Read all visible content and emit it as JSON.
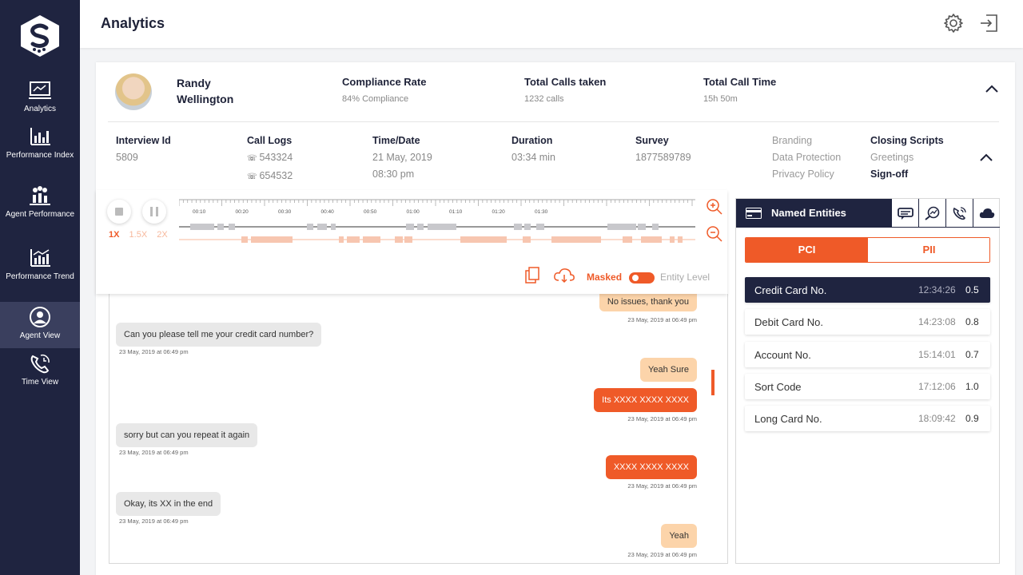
{
  "header": {
    "title": "Analytics"
  },
  "sidebar": {
    "items": [
      {
        "label": "Analytics",
        "icon": "monitor-analytics-icon"
      },
      {
        "label": "Performance Index",
        "icon": "bar-chart-icon"
      },
      {
        "label": "Agent Performance",
        "icon": "agents-chart-icon"
      },
      {
        "label": "Performance Trend",
        "icon": "trend-chart-icon"
      },
      {
        "label": "Agent View",
        "icon": "user-icon"
      },
      {
        "label": "Time View",
        "icon": "phone-clock-icon"
      }
    ],
    "active": "Agent View"
  },
  "agent": {
    "first_name": "Randy",
    "last_name": "Wellington",
    "stats": [
      {
        "label": "Compliance Rate",
        "value": "84% Compliance"
      },
      {
        "label": "Total Calls taken",
        "value": "1232 calls"
      },
      {
        "label": "Total Call Time",
        "value": "15h 50m"
      }
    ]
  },
  "call": {
    "interview_id_label": "Interview Id",
    "interview_id": "5809",
    "call_logs_label": "Call Logs",
    "call_logs": [
      "543324",
      "654532"
    ],
    "time_label": "Time/Date",
    "date": "21 May, 2019",
    "time": "08:30 pm",
    "duration_label": "Duration",
    "duration": "03:34 min",
    "survey_label": "Survey",
    "survey": "1877589789",
    "tags_col1": [
      "Branding",
      "Data Protection",
      "Privacy Policy"
    ],
    "tags_col2": [
      "Closing Scripts",
      "Greetings",
      "Sign-off"
    ]
  },
  "player": {
    "speeds": [
      "1X",
      "1.5X",
      "2X"
    ],
    "selected_speed": "1X",
    "ticks": [
      "00:10",
      "00:20",
      "00:30",
      "00:40",
      "00:50",
      "01:00",
      "01:10",
      "01:20",
      "01:30"
    ],
    "masked_label": "Masked",
    "entity_level_label": "Entity Level",
    "accent": "#ef5a28"
  },
  "chat": {
    "messages": [
      {
        "side": "out",
        "style": "light",
        "text": "No issues, thank you",
        "ts": "23 May, 2019 at 06:49 pm"
      },
      {
        "side": "in",
        "style": "grey",
        "text": "Can you please tell me your credit card number?",
        "ts": "23 May, 2019 at 06:49 pm"
      },
      {
        "side": "out",
        "style": "light",
        "text": "Yeah Sure",
        "ts": ""
      },
      {
        "side": "out",
        "style": "red",
        "text": "Its XXXX XXXX XXXX",
        "ts": "23 May, 2019 at 06:49 pm"
      },
      {
        "side": "in",
        "style": "grey",
        "text": "sorry but can you repeat it again",
        "ts": "23 May, 2019 at 06:49 pm"
      },
      {
        "side": "out",
        "style": "red",
        "text": "XXXX XXXX XXXX",
        "ts": "23 May, 2019 at 06:49 pm"
      },
      {
        "side": "in",
        "style": "grey",
        "text": "Okay, its XX in the end",
        "ts": "23 May, 2019 at 06:49 pm"
      },
      {
        "side": "out",
        "style": "light",
        "text": "Yeah",
        "ts": "23 May, 2019 at 06:49 pm"
      }
    ]
  },
  "entities": {
    "title": "Named Entities",
    "tabs": [
      "PCI",
      "PII"
    ],
    "selected_tab": "PCI",
    "rows": [
      {
        "name": "Credit Card No.",
        "time": "12:34:26",
        "score": "0.5"
      },
      {
        "name": "Debit Card No.",
        "time": "14:23:08",
        "score": "0.8"
      },
      {
        "name": "Account No.",
        "time": "15:14:01",
        "score": "0.7"
      },
      {
        "name": "Sort Code",
        "time": "17:12:06",
        "score": "1.0"
      },
      {
        "name": "Long Card No.",
        "time": "18:09:42",
        "score": "0.9"
      }
    ]
  }
}
